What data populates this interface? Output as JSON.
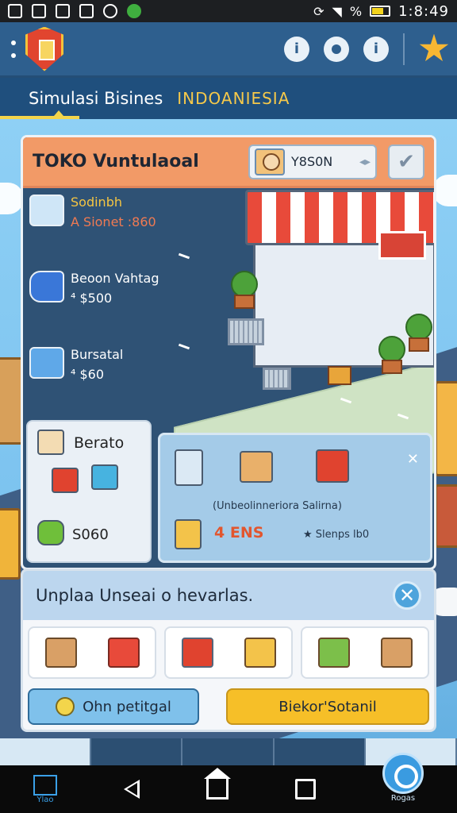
{
  "status_bar": {
    "time": "1:8:49",
    "signal_text": "%"
  },
  "app_header": {
    "tab_title": "Simulasi Bisines",
    "tab_subtitle": "INDOANIESIA"
  },
  "shop_panel": {
    "title": "TOKO Vuntulaoal",
    "player_name": "Y8S0N",
    "chip_arrows": "◂▸",
    "items": [
      {
        "name": "Sodinbh",
        "price": "A Sionet :860"
      },
      {
        "name": "Beoon Vahtag",
        "price": "⁴ $500"
      },
      {
        "name": "Bursatal",
        "price": "⁴ $60"
      }
    ],
    "card_left": {
      "title": "Berato",
      "price": "S060"
    },
    "card_right": {
      "caption": "(Unbeolinneriora Salirna)",
      "count": "4 ENS",
      "count_label": "★ Slenps lb0"
    }
  },
  "upgrade_dialog": {
    "title": "Unplaa Unseai o hevarlas.",
    "primary_button": "Ohn petitgal",
    "secondary_button": "Biekor'Sotanil"
  },
  "android_nav": {
    "left_label": "Ylao",
    "right_label": "Rogas"
  },
  "colors": {
    "header_blue": "#2e5f8e",
    "panel_orange": "#f29a67",
    "accent_yellow": "#f6bf28",
    "sky_blue": "#7cc3ef"
  },
  "icons": {
    "logo": "shield-logo-icon",
    "help": "info-icon",
    "settings": "gear-icon",
    "reward": "spark-icon",
    "close": "close-icon"
  }
}
